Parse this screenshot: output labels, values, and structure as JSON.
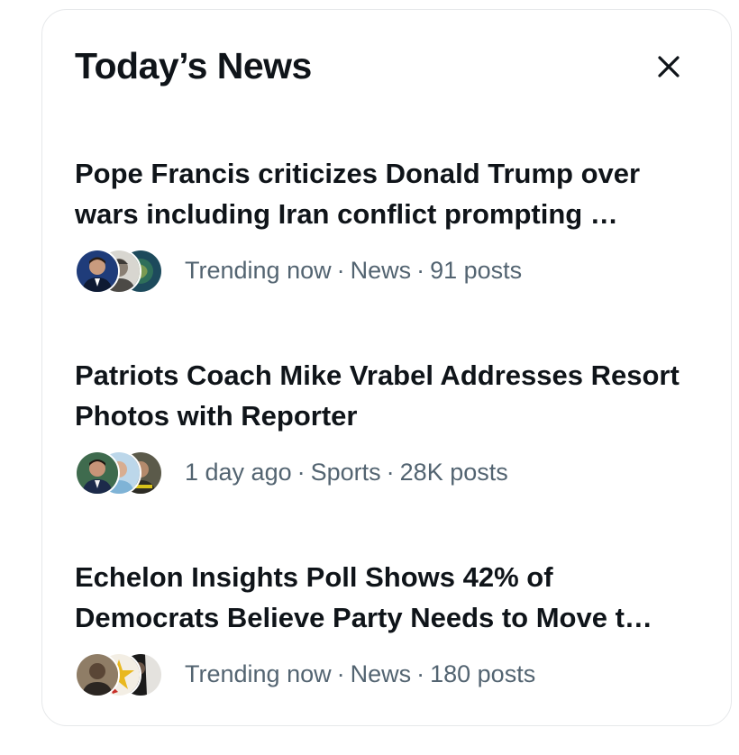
{
  "panel": {
    "title": "Today’s News",
    "close_icon": "close-icon"
  },
  "colors": {
    "headline": "#0f1419",
    "meta": "#536471",
    "border": "#e6e8ea"
  },
  "stories": [
    {
      "headline": "Pope Francis criticizes Donald Trump over wars including Iran conflict prompting …",
      "time": "Trending now",
      "category": "News",
      "posts": "91 posts",
      "separator": "·"
    },
    {
      "headline": "Patriots Coach Mike Vrabel Addresses Resort Photos with Reporter",
      "time": "1 day ago",
      "category": "Sports",
      "posts": "28K posts",
      "separator": "·"
    },
    {
      "headline": "Echelon Insights Poll Shows 42% of Democrats Believe Party Needs to Move t…",
      "time": "Trending now",
      "category": "News",
      "posts": "180 posts",
      "separator": "·"
    }
  ]
}
